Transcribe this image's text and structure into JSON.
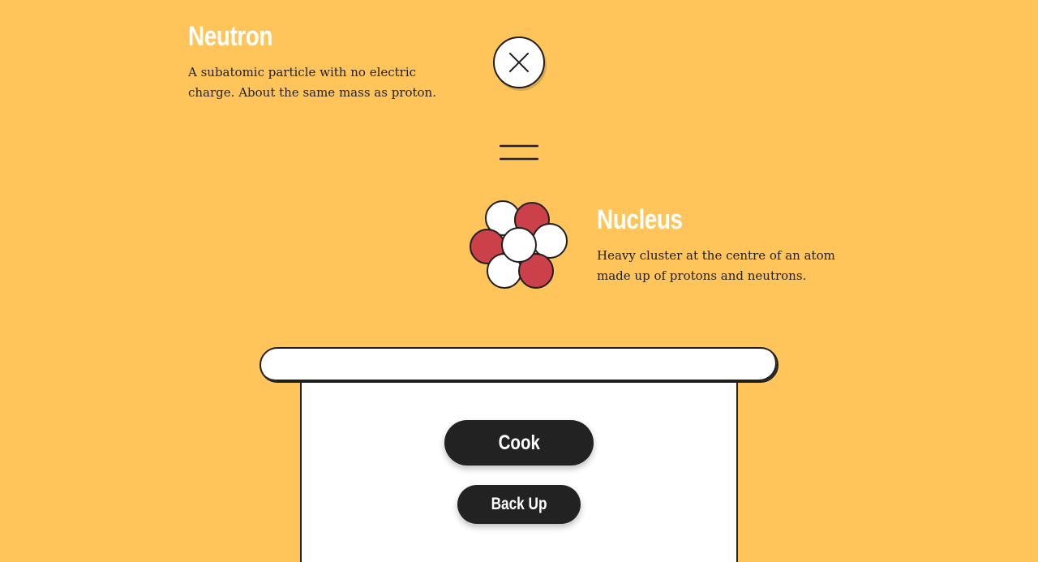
{
  "neutron": {
    "title": "Neutron",
    "description": "A subatomic particle with no electric charge. About the same mass as proton."
  },
  "nucleus": {
    "title": "Nucleus",
    "description": "Heavy cluster at the centre of an atom made up of protons and neutrons."
  },
  "icons": {
    "close": "close-icon",
    "equals": "equals-icon",
    "nucleus": "nucleus-icon"
  },
  "buttons": {
    "cook": "Cook",
    "back_up": "Back Up"
  },
  "colors": {
    "background": "#FFC55A",
    "proton": "#CC4049",
    "neutron": "#FFFFFF",
    "button": "#222222"
  }
}
